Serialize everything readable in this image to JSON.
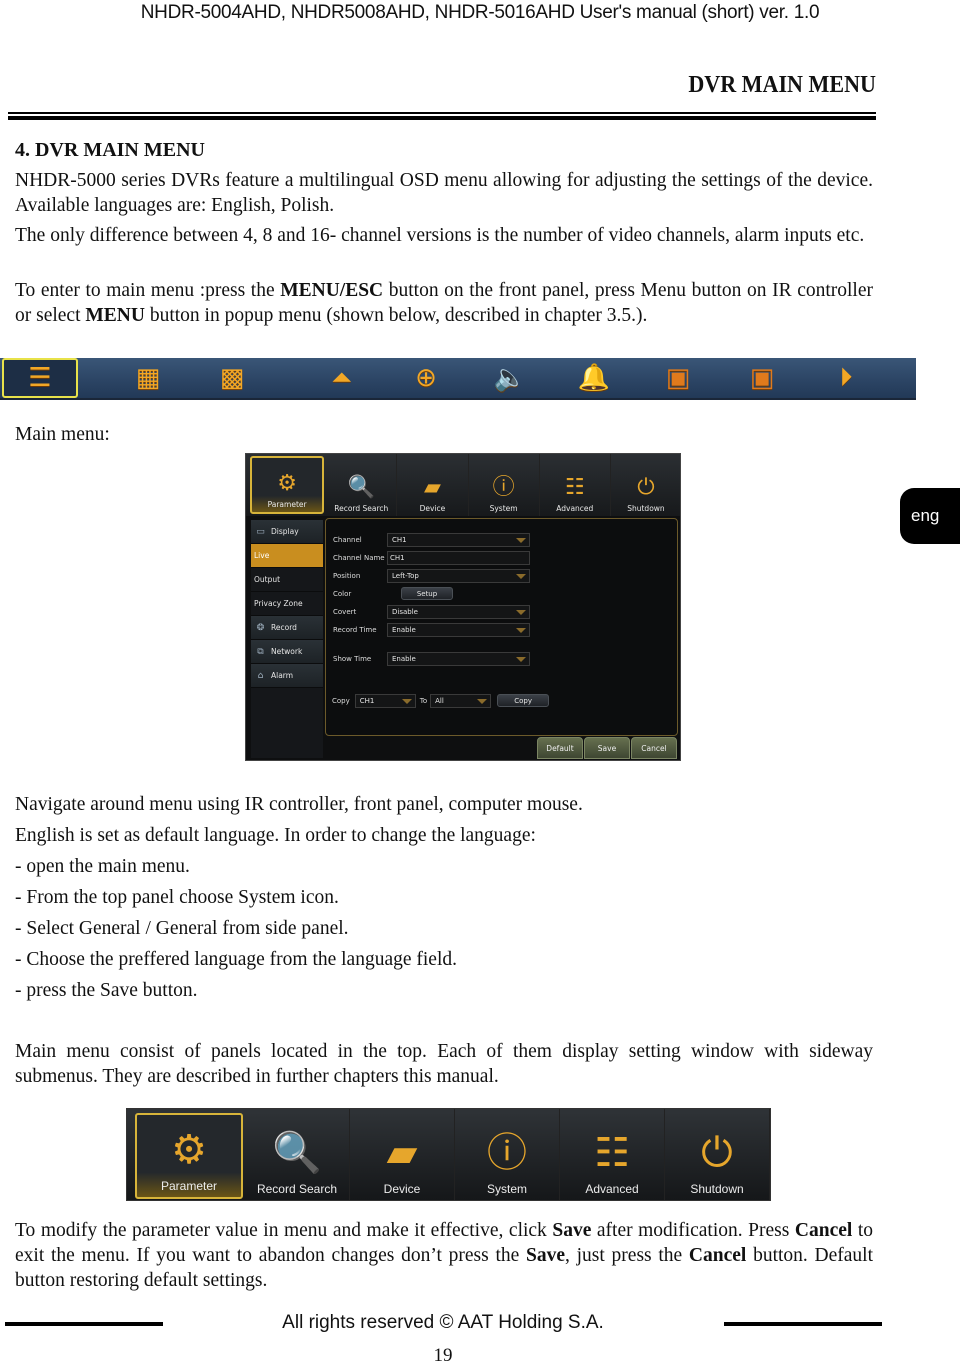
{
  "header": {
    "running_title": "NHDR-5004AHD, NHDR5008AHD, NHDR-5016AHD User's manual (short) ver. 1.0",
    "section_title": "DVR MAIN MENU"
  },
  "section": {
    "heading": "4. DVR MAIN MENU",
    "intro_1": "NHDR-5000 series DVRs feature a multilingual OSD menu allowing for adjusting the settings of the device. Available languages are: English, Polish.",
    "intro_2": "The only difference between 4, 8 and 16- channel versions is the number of video channels, alarm inputs etc.",
    "enter_menu": {
      "part1": "To enter to main menu :press the ",
      "bold1": "MENU/ESC",
      "part2": " button on the front panel, press Menu button on IR controller or select ",
      "bold2": "MENU",
      "part3": " button in popup menu (shown below, described in chapter 3.5.)."
    }
  },
  "popup_menu": {
    "buttons": [
      {
        "name": "menu",
        "glyph": "☰",
        "selected": true
      },
      {
        "name": "quad-view",
        "glyph": "▦"
      },
      {
        "name": "nine-view",
        "glyph": "▦"
      },
      {
        "name": "ptz-up",
        "glyph": "⏶"
      },
      {
        "name": "ptz-control",
        "glyph": "⊕"
      },
      {
        "name": "audio",
        "glyph": "🔈"
      },
      {
        "name": "alarm-bell",
        "glyph": "🔔"
      },
      {
        "name": "record-start",
        "glyph": "▣"
      },
      {
        "name": "record-stop",
        "glyph": "▣"
      },
      {
        "name": "playback",
        "glyph": "▶"
      }
    ]
  },
  "main_menu_label": "Main menu:",
  "dvr_menu": {
    "tabs": [
      {
        "label": "Parameter",
        "glyph": "⚙",
        "active": true
      },
      {
        "label": "Record Search",
        "glyph": "🔍"
      },
      {
        "label": "Device",
        "glyph": "▰"
      },
      {
        "label": "System",
        "glyph": "ⓘ"
      },
      {
        "label": "Advanced",
        "glyph": "☷"
      },
      {
        "label": "Shutdown",
        "glyph": "⏻"
      }
    ],
    "sidebar": [
      {
        "label": "Display",
        "group": true,
        "icon": "monitor"
      },
      {
        "label": "Live",
        "active": true
      },
      {
        "label": "Output"
      },
      {
        "label": "Privacy Zone"
      },
      {
        "label": "Record",
        "group": true,
        "icon": "record"
      },
      {
        "label": "Network",
        "group": true,
        "icon": "network"
      },
      {
        "label": "Alarm",
        "group": true,
        "icon": "alarm"
      }
    ],
    "fields": {
      "channel": {
        "label": "Channel",
        "value": "CH1"
      },
      "channel_name": {
        "label": "Channel Name",
        "value": "CH1"
      },
      "position": {
        "label": "Position",
        "value": "Left-Top"
      },
      "color": {
        "label": "Color",
        "button": "Setup"
      },
      "covert": {
        "label": "Covert",
        "value": "Disable"
      },
      "record_time": {
        "label": "Record Time",
        "value": "Enable"
      },
      "show_time": {
        "label": "Show Time",
        "value": "Enable"
      }
    },
    "copy": {
      "label": "Copy",
      "from": "CH1",
      "to_label": "To",
      "to": "All",
      "button": "Copy"
    },
    "actions": {
      "default": "Default",
      "save": "Save",
      "cancel": "Cancel"
    }
  },
  "language_tab": "eng",
  "navigation": {
    "line1": "Navigate around menu using IR controller, front panel, computer mouse.",
    "line2": "English is set as default language. In order to change the language:",
    "steps": [
      "- open the main menu.",
      "- From the top panel choose System icon.",
      "- Select General / General from side panel.",
      "- Choose the preffered language from the language field.",
      "- press the Save button."
    ]
  },
  "panels_text": "Main menu consist of panels located in the top. Each of them display setting window with sideway submenus. They are described in further chapters this manual.",
  "toolbar_2": {
    "tabs": [
      {
        "label": "Parameter",
        "glyph": "⚙",
        "active": true
      },
      {
        "label": "Record Search",
        "glyph": "🔍"
      },
      {
        "label": "Device",
        "glyph": "▰"
      },
      {
        "label": "System",
        "glyph": "ⓘ"
      },
      {
        "label": "Advanced",
        "glyph": "☷"
      },
      {
        "label": "Shutdown",
        "glyph": "⏻"
      }
    ]
  },
  "save_cancel_text": {
    "p1": "To modify the parameter value in menu and make it effective, click ",
    "b1": "Save",
    "p2": " after modification. Press ",
    "b2": "Cancel",
    "p3": " to exit the menu. If you want to abandon changes don’t press the ",
    "b3": "Save",
    "p4": ", just press the ",
    "b4": "Cancel",
    "p5": " button. Default button restoring default settings."
  },
  "footer": {
    "copyright": "All rights reserved © AAT Holding S.A.",
    "page_number": "19"
  },
  "colors": {
    "accent_gold": "#e6a62c",
    "active_sidebar": "#c98e1f",
    "popup_bar": "#2c4565",
    "selection_border": "#e8e24a"
  }
}
